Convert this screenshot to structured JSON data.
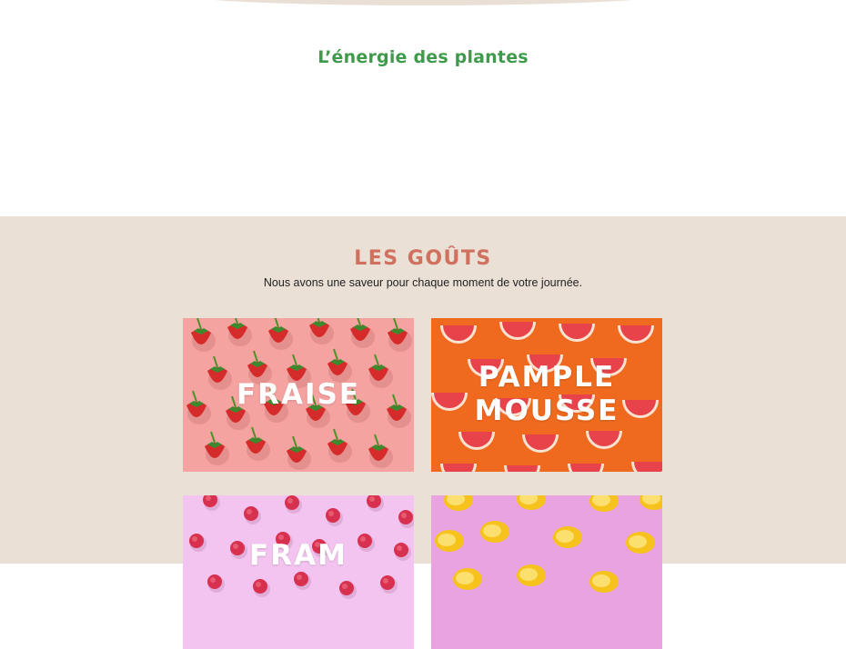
{
  "hero": {
    "tagline": "L’énergie des plantes"
  },
  "flavors": {
    "title": "LES GOÛTS",
    "subtitle": "Nous avons une saveur pour chaque moment de votre journée.",
    "cards": [
      {
        "label_line1": "FRAISE",
        "label_line2": "",
        "fruit": "strawberry",
        "bg": "#f5a3a1"
      },
      {
        "label_line1": "PAMPLE",
        "label_line2": "MOUSSE",
        "fruit": "grapefruit",
        "bg": "#ef6a1e"
      },
      {
        "label_line1": "FRAM",
        "label_line2": "",
        "fruit": "raspberry",
        "bg": "#f2c4ef"
      },
      {
        "label_line1": "",
        "label_line2": "",
        "fruit": "lemon",
        "bg": "#e9a3e0"
      }
    ]
  },
  "colors": {
    "tagline_green": "#3f9a4b",
    "section_bg": "#ebe0d6",
    "title_coral": "#d0705f"
  }
}
